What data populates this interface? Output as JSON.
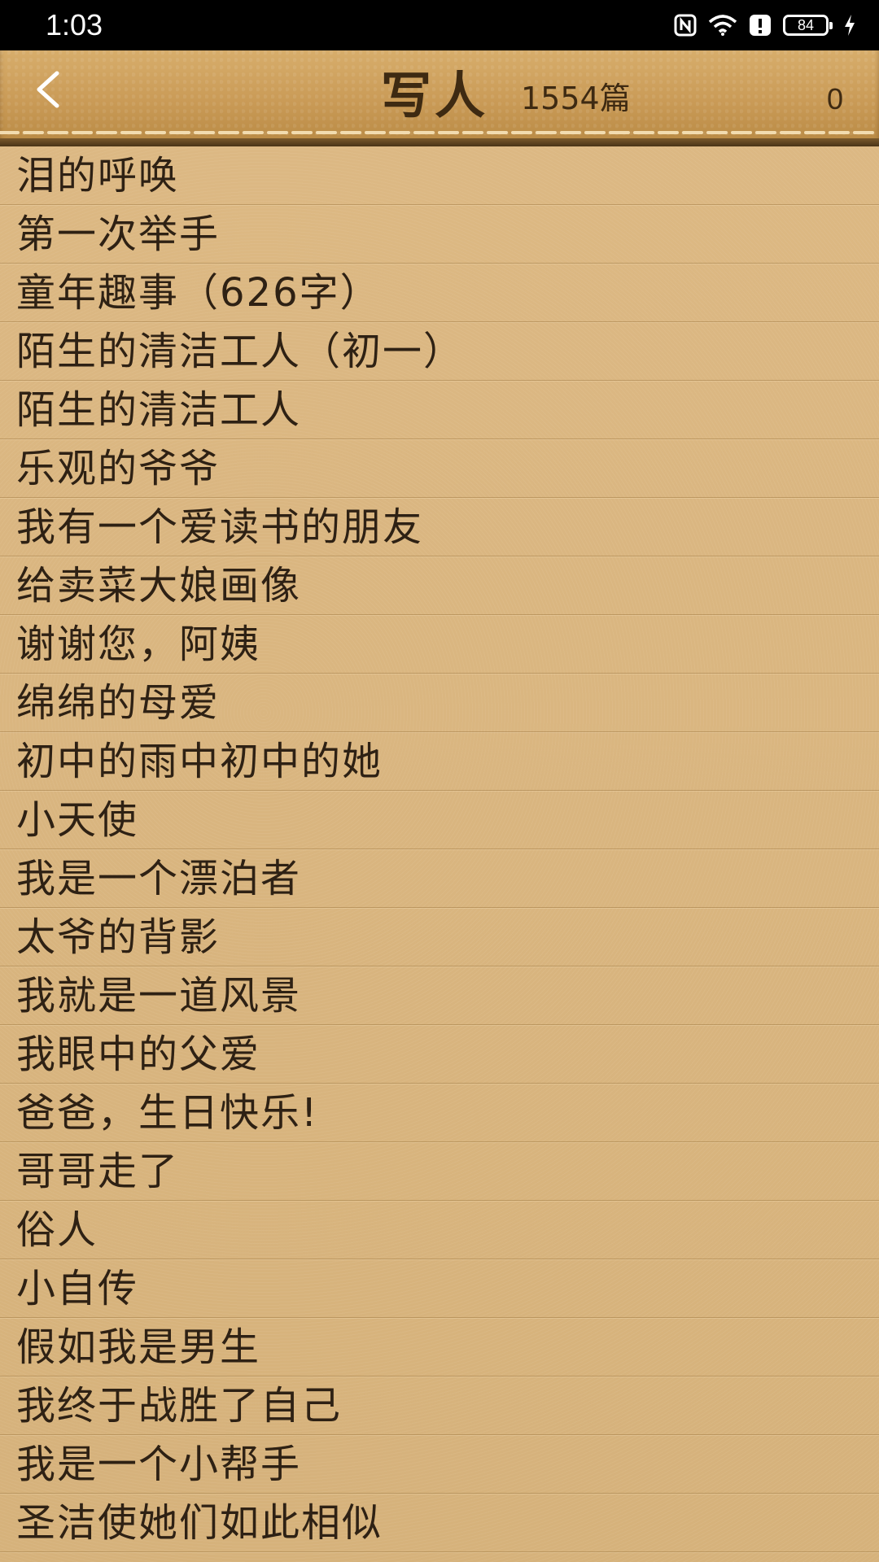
{
  "status_bar": {
    "time": "1:03",
    "battery": "84",
    "icons": [
      "nfc-icon",
      "wifi-icon",
      "alert-icon",
      "battery-icon",
      "charging-icon"
    ]
  },
  "header": {
    "title": "写人",
    "count": "1554篇",
    "right_value": "0",
    "back_icon": "chevron-left-icon"
  },
  "articles": [
    "泪的呼唤",
    "第一次举手",
    "童年趣事（626字）",
    "陌生的清洁工人（初一）",
    "陌生的清洁工人",
    "乐观的爷爷",
    "我有一个爱读书的朋友",
    "给卖菜大娘画像",
    "谢谢您，阿姨",
    "绵绵的母爱",
    "初中的雨中初中的她",
    "小天使",
    "我是一个漂泊者",
    "太爷的背影",
    "我就是一道风景",
    "我眼中的父爱",
    "爸爸，生日快乐!",
    "哥哥走了",
    "俗人",
    "小自传",
    "假如我是男生",
    "我终于战胜了自己",
    "我是一个小帮手",
    "圣洁使她们如此相似"
  ],
  "colors": {
    "background": "#d8b57c",
    "text": "#2e2114",
    "header_text": "#3e2a12",
    "status_bar": "#000000"
  }
}
